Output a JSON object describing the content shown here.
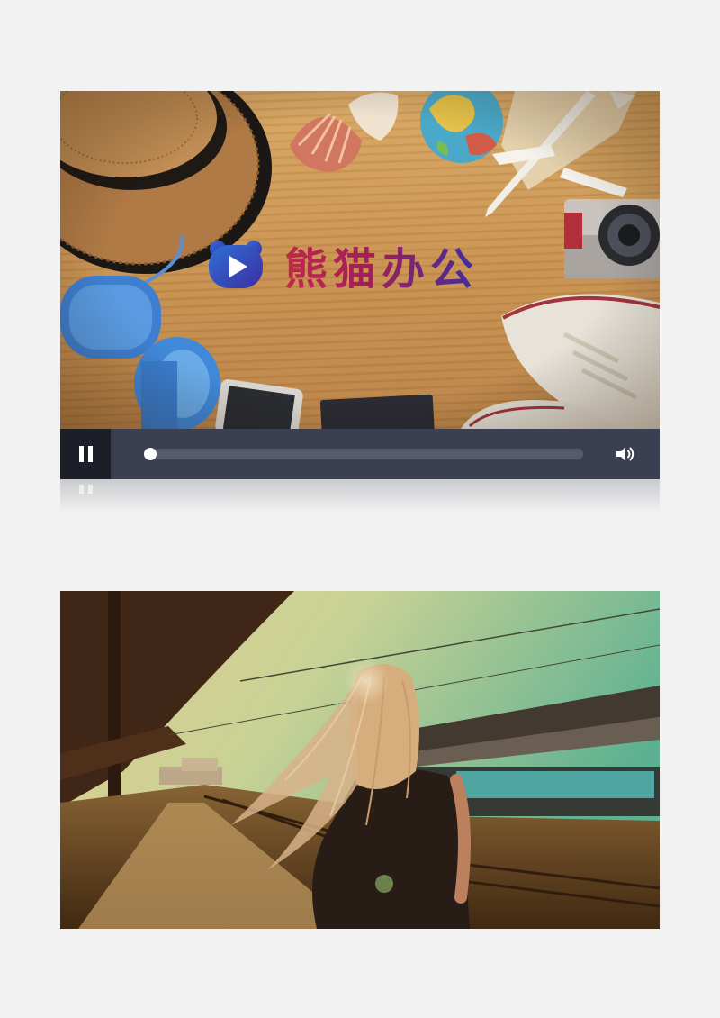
{
  "video_player": {
    "brand_text": "熊猫办公",
    "brand_icon": "bear-play-icon",
    "state": "playing",
    "progress": 0.0,
    "controls": {
      "play_pause_icon": "pause-icon",
      "volume_icon": "volume-icon"
    },
    "colors": {
      "control_bar": "#3a3f52",
      "play_button_bg": "#1d1f28",
      "track": "#565b6d",
      "brand_gradient": [
        "#c0284a",
        "#3b2fa0"
      ]
    }
  },
  "second_image": {
    "subject": "train-platform-photo"
  }
}
